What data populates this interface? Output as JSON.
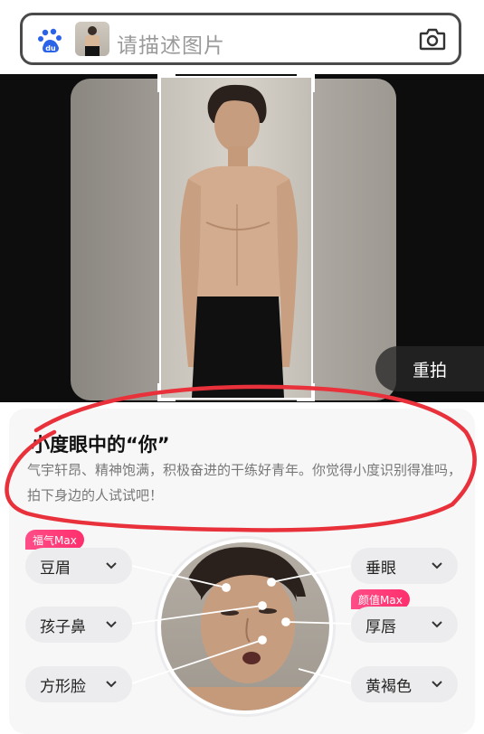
{
  "search": {
    "placeholder": "请描述图片",
    "icons": [
      "baidu-logo-icon",
      "camera-icon"
    ]
  },
  "photo": {
    "retake_label": "重拍"
  },
  "result": {
    "title": "小度眼中的“你”",
    "description": "气宇轩昂、精神饱满，积极奋进的干练好青年。你觉得小度识别得准吗，拍下身边的人试试吧！"
  },
  "features": {
    "left": [
      {
        "label": "豆眉",
        "tag": "福气Max"
      },
      {
        "label": "孩子鼻",
        "tag": ""
      },
      {
        "label": "方形脸",
        "tag": ""
      }
    ],
    "right": [
      {
        "label": "垂眼",
        "tag": ""
      },
      {
        "label": "厚唇",
        "tag": "颜值Max"
      },
      {
        "label": "黄褐色",
        "tag": ""
      }
    ]
  },
  "colors": {
    "accent_tag": "#ff3a74",
    "annotation_circle": "#e8313a",
    "baidu_blue": "#2b63e8"
  }
}
